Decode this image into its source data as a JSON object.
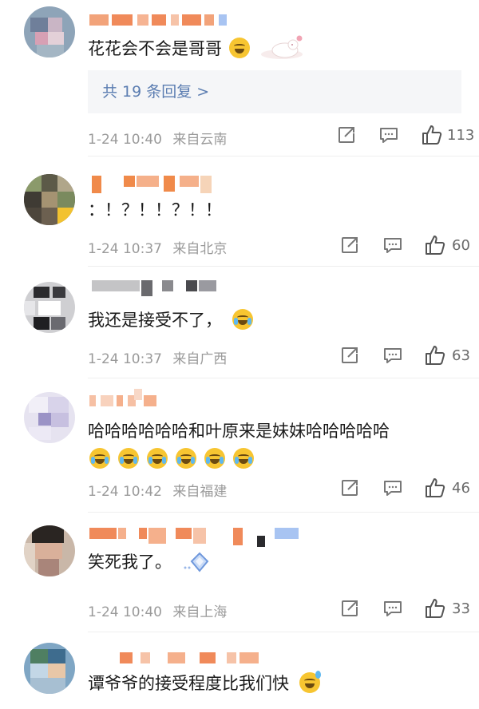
{
  "comments": [
    {
      "text": "花花会不会是哥哥",
      "reply_label": "共 19 条回复 >",
      "time": "1-24 10:40",
      "location": "来自云南",
      "likes": "113"
    },
    {
      "text": "：！？！！？！！",
      "time": "1-24 10:37",
      "location": "来自北京",
      "likes": "60"
    },
    {
      "text": "我还是接受不了，",
      "time": "1-24 10:37",
      "location": "来自广西",
      "likes": "63"
    },
    {
      "text": "哈哈哈哈哈哈和叶原来是妹妹哈哈哈哈哈",
      "time": "1-24 10:42",
      "location": "来自福建",
      "likes": "46"
    },
    {
      "text": "笑死我了。",
      "time": "1-24 10:40",
      "location": "来自上海",
      "likes": "33"
    },
    {
      "text": "谭爷爷的接受程度比我们快"
    }
  ],
  "icons": [
    "share-icon",
    "comment-icon",
    "like-icon",
    "grin-sweat-emoji",
    "crying-laugh-emoji",
    "diamond-sticker-icon",
    "cat-sticker"
  ],
  "colors": {
    "reply_link": "#5b7db1",
    "meta": "#9a9a9a",
    "reply_bg": "#f5f6f8"
  }
}
